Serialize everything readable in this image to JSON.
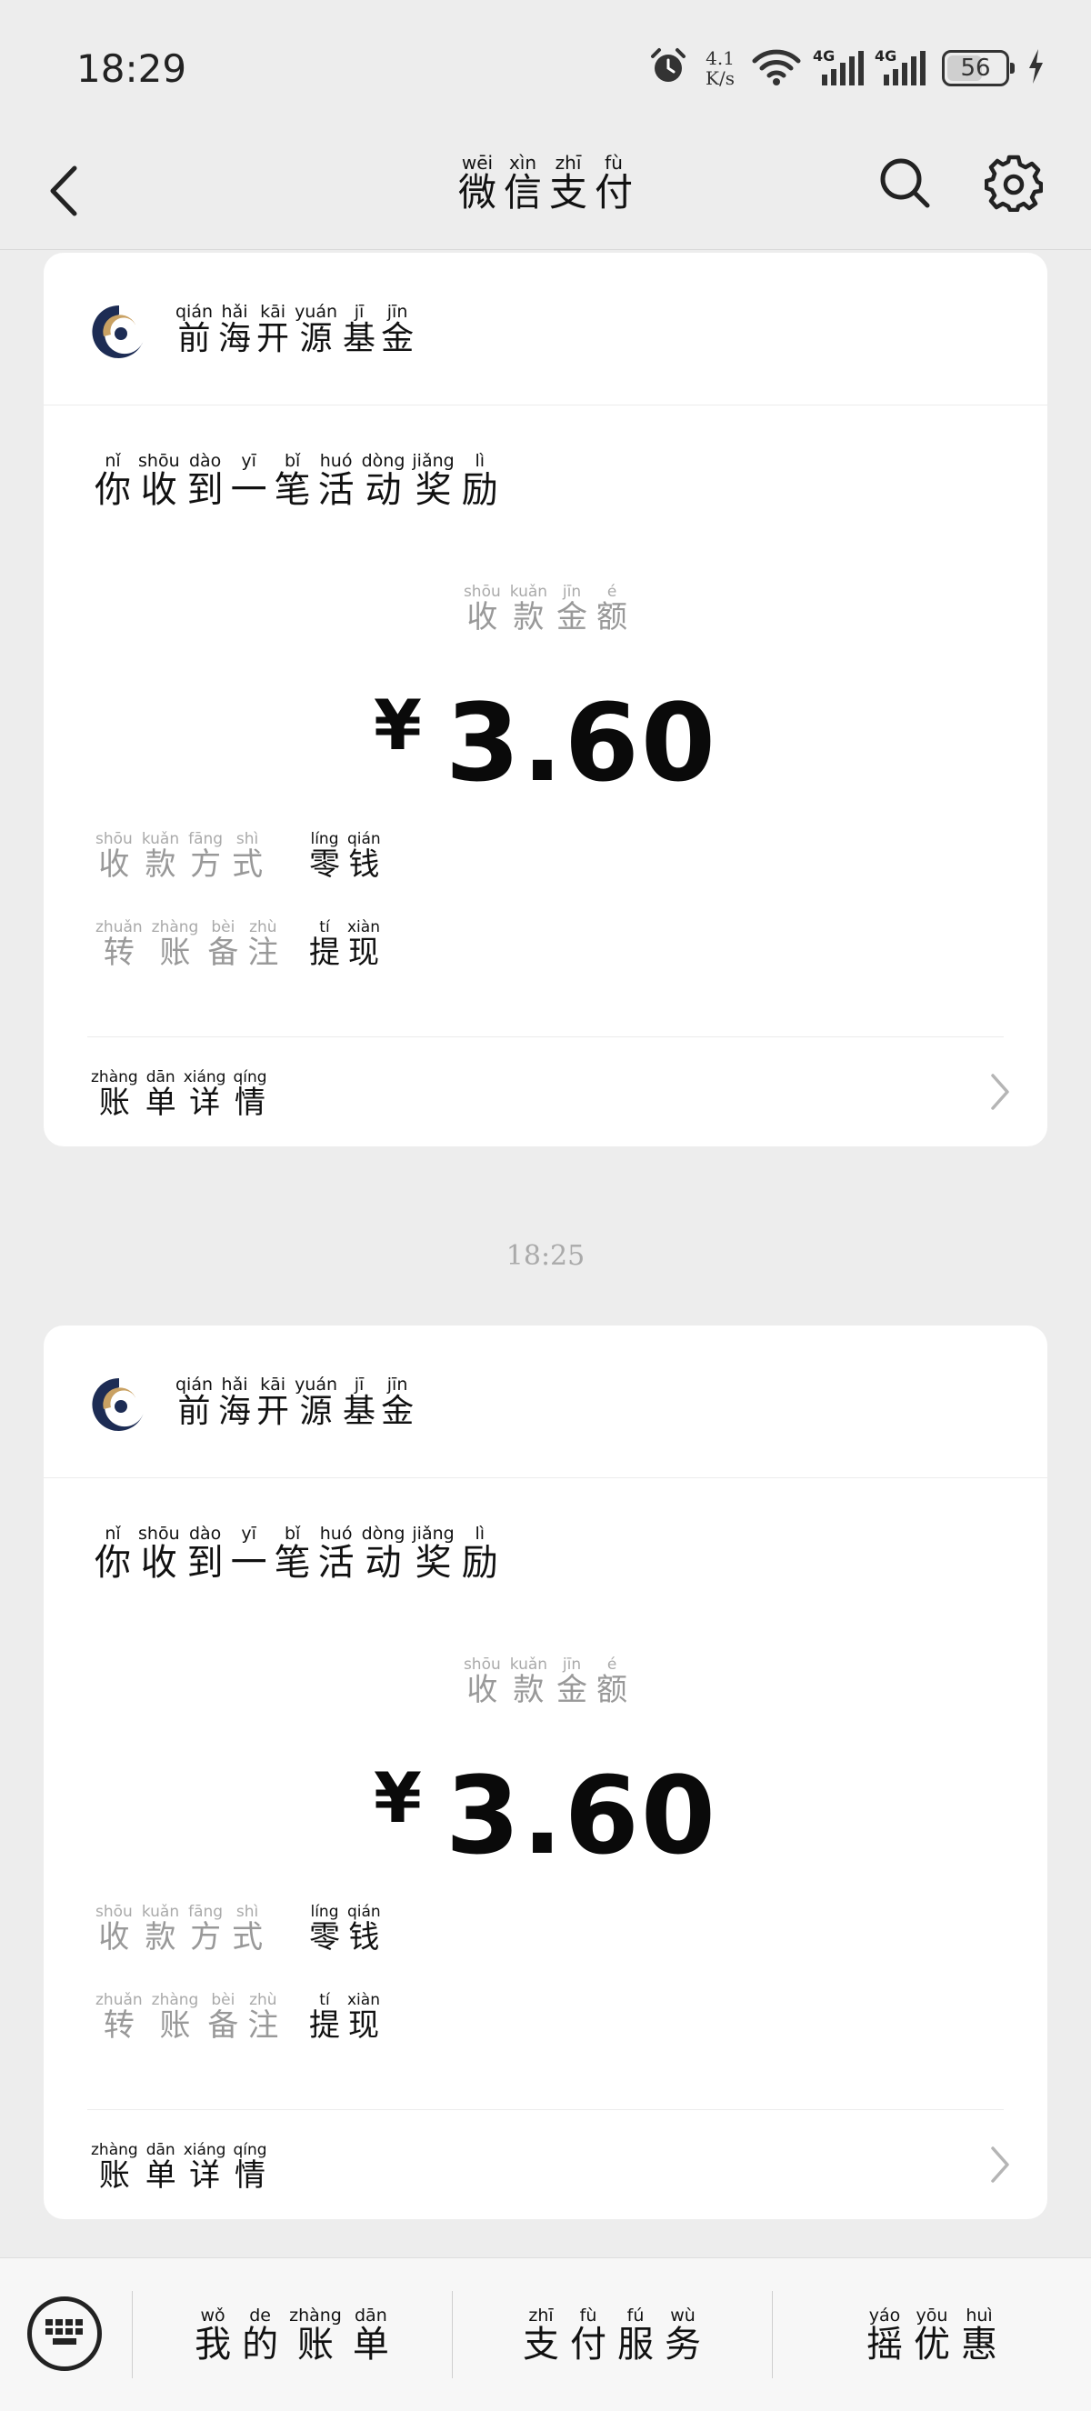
{
  "status_bar": {
    "time": "18:29",
    "net_speed_value": "4.1",
    "net_speed_unit": "K/s",
    "signal_1": "4G",
    "signal_2": "4G",
    "battery": "56"
  },
  "nav": {
    "title": [
      {
        "p": "wēi",
        "h": "微"
      },
      {
        "p": "xìn",
        "h": "信"
      },
      {
        "p": "zhī",
        "h": "支"
      },
      {
        "p": "fù",
        "h": "付"
      }
    ],
    "icons": {
      "back": "chevron-left-icon",
      "search": "search-icon",
      "settings": "gear-icon"
    }
  },
  "cards": [
    {
      "org": [
        {
          "p": "qián",
          "h": "前"
        },
        {
          "p": "hǎi",
          "h": "海"
        },
        {
          "p": "kāi",
          "h": "开"
        },
        {
          "p": "yuán",
          "h": "源"
        },
        {
          "p": "jī",
          "h": "基"
        },
        {
          "p": "jīn",
          "h": "金"
        }
      ],
      "headline": [
        {
          "p": "nǐ",
          "h": "你"
        },
        {
          "p": "shōu",
          "h": "收"
        },
        {
          "p": "dào",
          "h": "到"
        },
        {
          "p": "yī",
          "h": "一"
        },
        {
          "p": "bǐ",
          "h": "笔"
        },
        {
          "p": "huó",
          "h": "活"
        },
        {
          "p": "dòng",
          "h": "动"
        },
        {
          "p": "jiǎng",
          "h": "奖"
        },
        {
          "p": "lì",
          "h": "励"
        }
      ],
      "amount_label": [
        {
          "p": "shōu",
          "h": "收"
        },
        {
          "p": "kuǎn",
          "h": "款"
        },
        {
          "p": "jīn",
          "h": "金"
        },
        {
          "p": "é",
          "h": "额"
        }
      ],
      "currency": "¥",
      "amount": "3.60",
      "method_label": [
        {
          "p": "shōu",
          "h": "收"
        },
        {
          "p": "kuǎn",
          "h": "款"
        },
        {
          "p": "fāng",
          "h": "方"
        },
        {
          "p": "shì",
          "h": "式"
        }
      ],
      "method_value": [
        {
          "p": "líng",
          "h": "零"
        },
        {
          "p": "qián",
          "h": "钱"
        }
      ],
      "remark_label": [
        {
          "p": "zhuǎn",
          "h": "转"
        },
        {
          "p": "zhàng",
          "h": "账"
        },
        {
          "p": "bèi",
          "h": "备"
        },
        {
          "p": "zhù",
          "h": "注"
        }
      ],
      "remark_value": [
        {
          "p": "tí",
          "h": "提"
        },
        {
          "p": "xiàn",
          "h": "现"
        }
      ],
      "footer": [
        {
          "p": "zhàng",
          "h": "账"
        },
        {
          "p": "dān",
          "h": "单"
        },
        {
          "p": "xiáng",
          "h": "详"
        },
        {
          "p": "qíng",
          "h": "情"
        }
      ]
    },
    {
      "org": [
        {
          "p": "qián",
          "h": "前"
        },
        {
          "p": "hǎi",
          "h": "海"
        },
        {
          "p": "kāi",
          "h": "开"
        },
        {
          "p": "yuán",
          "h": "源"
        },
        {
          "p": "jī",
          "h": "基"
        },
        {
          "p": "jīn",
          "h": "金"
        }
      ],
      "headline": [
        {
          "p": "nǐ",
          "h": "你"
        },
        {
          "p": "shōu",
          "h": "收"
        },
        {
          "p": "dào",
          "h": "到"
        },
        {
          "p": "yī",
          "h": "一"
        },
        {
          "p": "bǐ",
          "h": "笔"
        },
        {
          "p": "huó",
          "h": "活"
        },
        {
          "p": "dòng",
          "h": "动"
        },
        {
          "p": "jiǎng",
          "h": "奖"
        },
        {
          "p": "lì",
          "h": "励"
        }
      ],
      "amount_label": [
        {
          "p": "shōu",
          "h": "收"
        },
        {
          "p": "kuǎn",
          "h": "款"
        },
        {
          "p": "jīn",
          "h": "金"
        },
        {
          "p": "é",
          "h": "额"
        }
      ],
      "currency": "¥",
      "amount": "3.60",
      "method_label": [
        {
          "p": "shōu",
          "h": "收"
        },
        {
          "p": "kuǎn",
          "h": "款"
        },
        {
          "p": "fāng",
          "h": "方"
        },
        {
          "p": "shì",
          "h": "式"
        }
      ],
      "method_value": [
        {
          "p": "líng",
          "h": "零"
        },
        {
          "p": "qián",
          "h": "钱"
        }
      ],
      "remark_label": [
        {
          "p": "zhuǎn",
          "h": "转"
        },
        {
          "p": "zhàng",
          "h": "账"
        },
        {
          "p": "bèi",
          "h": "备"
        },
        {
          "p": "zhù",
          "h": "注"
        }
      ],
      "remark_value": [
        {
          "p": "tí",
          "h": "提"
        },
        {
          "p": "xiàn",
          "h": "现"
        }
      ],
      "footer": [
        {
          "p": "zhàng",
          "h": "账"
        },
        {
          "p": "dān",
          "h": "单"
        },
        {
          "p": "xiáng",
          "h": "详"
        },
        {
          "p": "qíng",
          "h": "情"
        }
      ]
    }
  ],
  "timestamp": "18:25",
  "tab_bar": {
    "keyboard_icon": "keyboard-icon",
    "tabs": [
      [
        {
          "p": "wǒ",
          "h": "我"
        },
        {
          "p": "de",
          "h": "的"
        },
        {
          "p": "zhàng",
          "h": "账"
        },
        {
          "p": "dān",
          "h": "单"
        }
      ],
      [
        {
          "p": "zhī",
          "h": "支"
        },
        {
          "p": "fù",
          "h": "付"
        },
        {
          "p": "fú",
          "h": "服"
        },
        {
          "p": "wù",
          "h": "务"
        }
      ],
      [
        {
          "p": "yáo",
          "h": "摇"
        },
        {
          "p": "yōu",
          "h": "优"
        },
        {
          "p": "huì",
          "h": "惠"
        }
      ]
    ]
  }
}
